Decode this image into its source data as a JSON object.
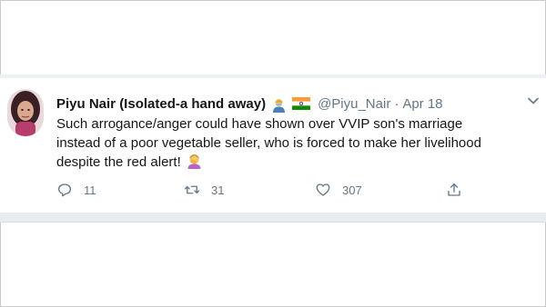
{
  "tweet": {
    "display_name": "Piyu Nair (Isolated-a hand away)",
    "handle": "@Piyu_Nair",
    "separator": "·",
    "date": "Apr 18",
    "text_lines": [
      "Such arrogance/anger could have shown over VVIP son's marriage",
      "instead of a poor vegetable seller, who is forced to make her livelihood",
      "despite the red alert!"
    ],
    "name_emojis": [
      "person-with-mask-emoji",
      "india-flag-emoji"
    ],
    "trailing_emoji": "face-palm-emoji",
    "actions": {
      "replies": "11",
      "retweets": "31",
      "likes": "307"
    }
  },
  "colors": {
    "primary_text": "#14171a",
    "secondary_text": "#657786",
    "divider": "#e6ecf0"
  }
}
